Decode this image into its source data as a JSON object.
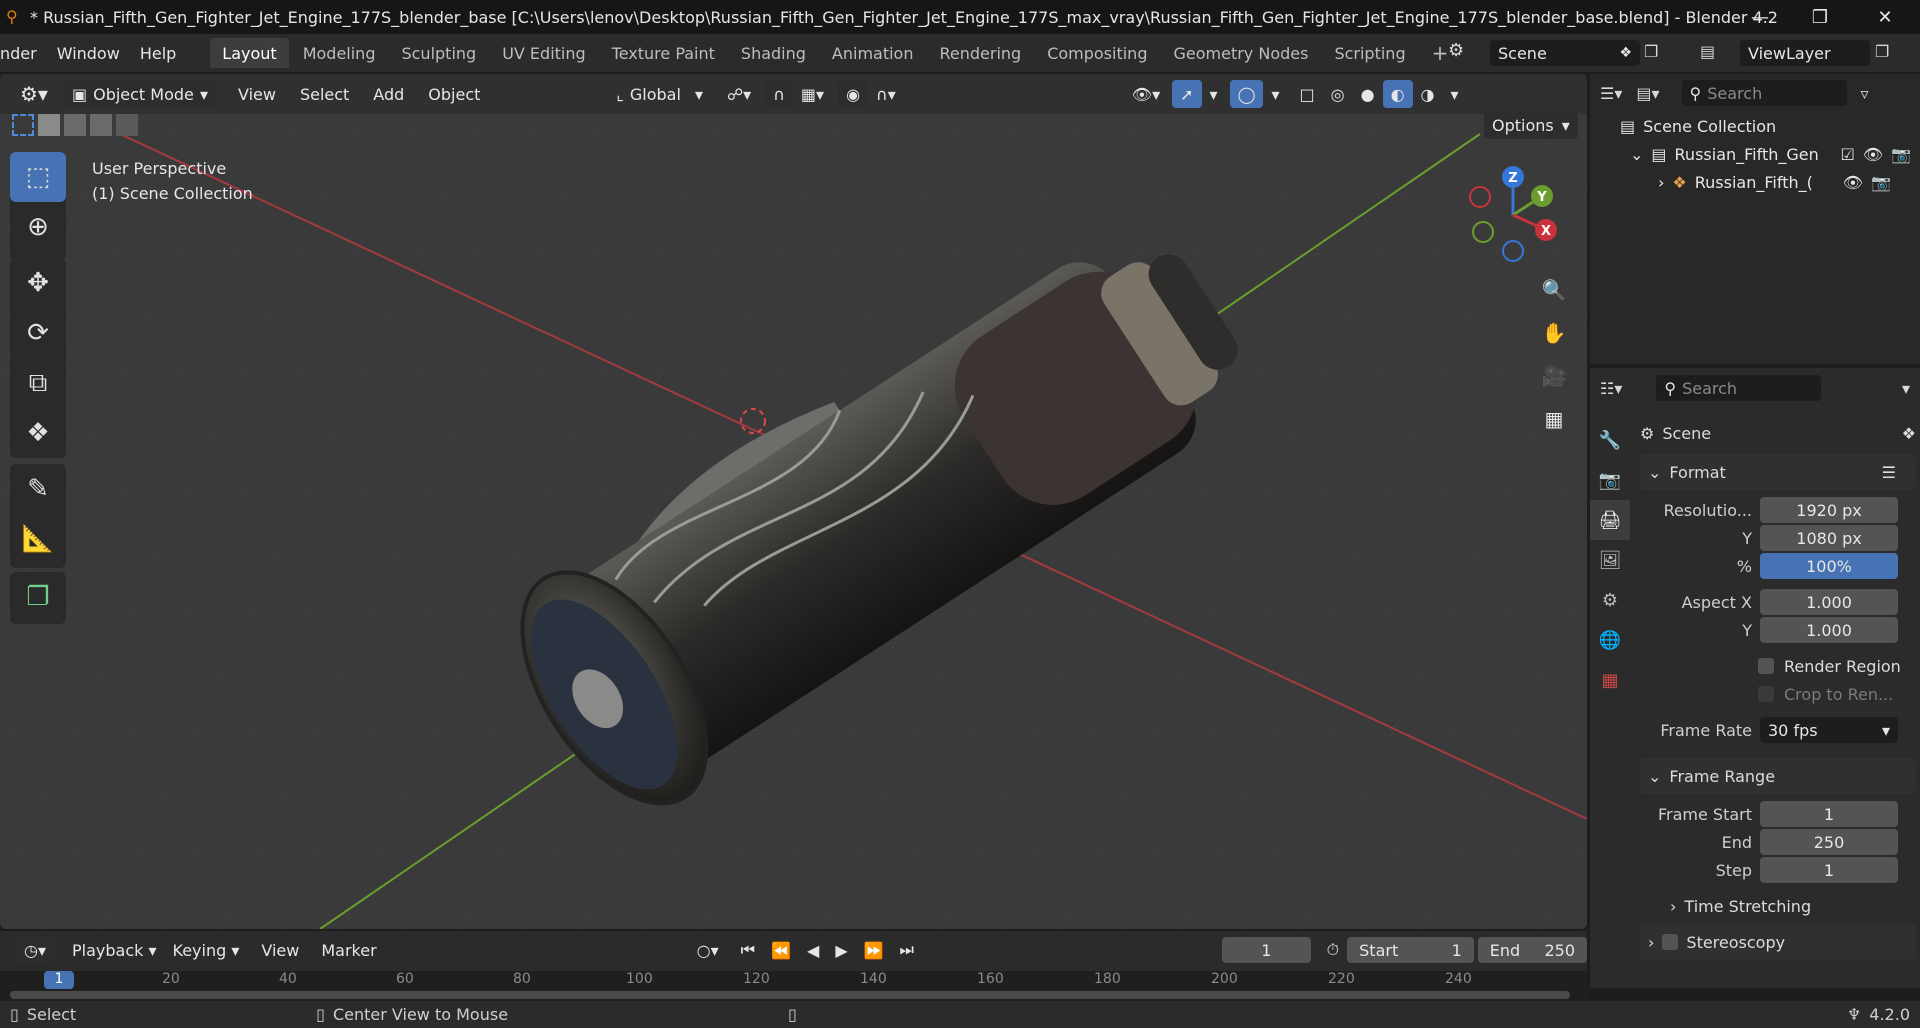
{
  "titlebar": {
    "title": "* Russian_Fifth_Gen_Fighter_Jet_Engine_177S_blender_base [C:\\Users\\lenov\\Desktop\\Russian_Fifth_Gen_Fighter_Jet_Engine_177S_max_vray\\Russian_Fifth_Gen_Fighter_Jet_Engine_177S_blender_base.blend] - Blender 4.2",
    "minimize": "—",
    "maximize": "❐",
    "close": "✕"
  },
  "menubar": {
    "menus": [
      "nder",
      "Window",
      "Help"
    ],
    "workspaces": [
      "Layout",
      "Modeling",
      "Sculpting",
      "UV Editing",
      "Texture Paint",
      "Shading",
      "Animation",
      "Rendering",
      "Compositing",
      "Geometry Nodes",
      "Scripting"
    ],
    "active_workspace": "Layout",
    "add_workspace": "+",
    "scene": "Scene",
    "view_layer": "ViewLayer"
  },
  "viewport": {
    "mode": "Object Mode",
    "menus": [
      "View",
      "Select",
      "Add",
      "Object"
    ],
    "orientation": "Global",
    "options": "Options",
    "overlay_line1": "User Perspective",
    "overlay_line2": "(1) Scene Collection",
    "gizmo": {
      "z": "Z",
      "y": "Y",
      "x": "X"
    }
  },
  "outliner": {
    "search_placeholder": "Search",
    "root": "Scene Collection",
    "collection": "Russian_Fifth_Gen",
    "object": "Russian_Fifth_("
  },
  "properties": {
    "search_placeholder": "Search",
    "context": "Scene",
    "format_panel": "Format",
    "resolution_label": "Resolutio...",
    "res_x": "1920 px",
    "y_label": "Y",
    "res_y": "1080 px",
    "pct_label": "%",
    "res_pct": "100%",
    "aspect_x_label": "Aspect X",
    "aspect_x": "1.000",
    "aspect_y_label": "Y",
    "aspect_y": "1.000",
    "render_region": "Render Region",
    "crop": "Crop to Ren...",
    "frame_rate_label": "Frame Rate",
    "frame_rate": "30 fps",
    "frame_range_panel": "Frame Range",
    "frame_start_label": "Frame Start",
    "frame_start": "1",
    "end_label": "End",
    "end": "250",
    "step_label": "Step",
    "step": "1",
    "time_stretching": "Time Stretching",
    "stereoscopy": "Stereoscopy"
  },
  "timeline": {
    "menus": [
      "Playback",
      "Keying",
      "View",
      "Marker"
    ],
    "current_frame": "1",
    "start_label": "Start",
    "start": "1",
    "end_label": "End",
    "end": "250",
    "ruler_current": "1",
    "ticks": [
      "20",
      "40",
      "60",
      "80",
      "100",
      "120",
      "140",
      "160",
      "180",
      "200",
      "220",
      "240"
    ]
  },
  "statusbar": {
    "select": "Select",
    "center": "Center View to Mouse",
    "version": "4.2.0"
  },
  "colors": {
    "accent": "#4772b3",
    "x_axis": "#c8323c",
    "y_axis": "#6b9e2e",
    "z_axis": "#3576d9"
  }
}
